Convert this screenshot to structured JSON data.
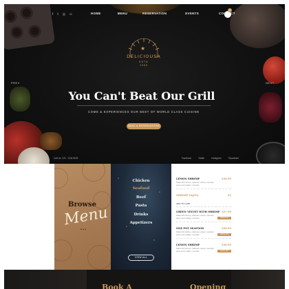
{
  "header": {
    "social_icons": [
      "facebook-icon",
      "twitter-icon",
      "instagram-icon",
      "tripadvisor-icon"
    ],
    "social_glyphs": [
      "f",
      "t",
      "◎",
      "∞"
    ],
    "nav": [
      "HOME",
      "MENU",
      "RESERVATION",
      "EVENTS",
      "CONTACT"
    ],
    "cart_count": "0"
  },
  "logo": {
    "brand": "DELICIOUSA",
    "est_line1": "ESTD",
    "est_line2": "1985"
  },
  "hero": {
    "prev_label": "PREV",
    "next_label": "NEXT",
    "headline": "You Can't Beat Our Grill",
    "subtitle": "Come & experiences our best of world class cuisine",
    "cta_label": "Make a reservations",
    "phone": "Call Us: 123 - 1234 5678",
    "footer_links": [
      "Facebook",
      "Twitter",
      "Instagram",
      "Tripadvisor"
    ]
  },
  "browse": {
    "title": "Browse",
    "script": "Menu",
    "dots": "• • •"
  },
  "categories": {
    "items": [
      "Chicken",
      "Seafood",
      "Beef",
      "Pasta",
      "Drinks",
      "Appetizers"
    ],
    "active": "Seafood",
    "view_all": "View All"
  },
  "menu_items": [
    {
      "name": "Lemon Shrimp",
      "price": "$36.99",
      "desc": "Filled with shrimp, calamari, clams, mussels, quinn and scallop, mussels",
      "tag": ""
    },
    {
      "name": "Shrimp Fajita",
      "price": "$5",
      "desc": "",
      "tag": ""
    },
    {
      "name": "Add to cart",
      "price": "",
      "desc": "",
      "tag": ""
    },
    {
      "name": "Green Velvet with Shrimp",
      "price": "$27.99",
      "desc": "Filled with shrimp, calamari, clams, mussels, quinn and scallop, mussels",
      "tag": "Add to cart"
    },
    {
      "name": "One Pot Seafood",
      "price": "$46.99",
      "desc": "Filled with shrimp, calamari, clams, mussels, quinn and scallop, mussels",
      "tag": "Add to cart"
    },
    {
      "name": "Lemon Shrimp",
      "price": "$36.99",
      "desc": "Filled with shrimp, calamari, clams, mussels, quinn and scallop, mussels",
      "tag": "Add to cart"
    }
  ],
  "bottom": {
    "left_heading": "Book A",
    "right_heading": "Opening"
  },
  "colors": {
    "gold": "#c79a5b",
    "dark": "#111111",
    "navy": "#1e2a3a",
    "tan": "#b88c63"
  }
}
